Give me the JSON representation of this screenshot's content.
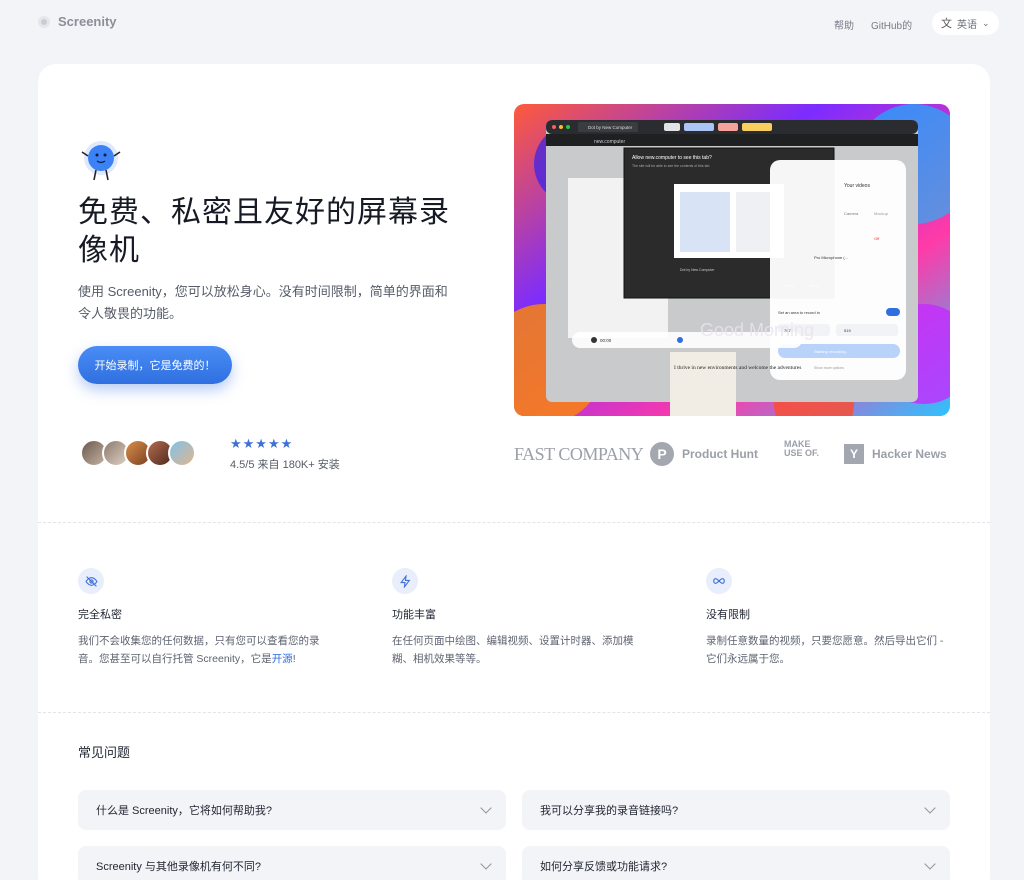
{
  "nav": {
    "brand": "Screenity",
    "help": "帮助",
    "github": "GitHub的",
    "language": "英语",
    "language_icon": "文"
  },
  "hero": {
    "title": "免费、私密且友好的屏幕录像机",
    "subtitle": "使用 Screenity，您可以放松身心。没有时间限制，简单的界面和令人敬畏的功能。",
    "cta": "开始录制，它是免费的！",
    "stars": "★★★★★",
    "rating": "4.5/5 来自 180K+ 安装"
  },
  "press": {
    "fast_company": "FAST COMPANY",
    "product_hunt": "Product Hunt",
    "product_hunt_letter": "P",
    "muo": "MAKE USE OF.",
    "hacker_news": "Hacker News",
    "hacker_news_letter": "Y"
  },
  "features": [
    {
      "icon": "eye-off-icon",
      "title": "完全私密",
      "desc_before": "我们不会收集您的任何数据，只有您可以查看您的录音。您甚至可以自行托管 Screenity，它是",
      "link": "开源",
      "desc_after": "!"
    },
    {
      "icon": "lightning-icon",
      "title": "功能丰富",
      "desc": "在任何页面中绘图、编辑视频、设置计时器、添加模糊、相机效果等等。"
    },
    {
      "icon": "infinity-icon",
      "title": "没有限制",
      "desc": "录制任意数量的视频，只要您愿意。然后导出它们 - 它们永远属于您。"
    }
  ],
  "faq": {
    "heading": "常见问题",
    "items": [
      "什么是 Screenity，它将如何帮助我?",
      "我可以分享我的录音链接吗?",
      "Screenity 与其他录像机有何不同?",
      "如何分享反馈或功能请求?"
    ]
  },
  "screenshot": {
    "dialog_title": "Allow new.computer to see this tab?",
    "dialog_sub": "The site will be able to see the contents of this tab",
    "dialog_tab": "Dot by New Computer",
    "dialog_cancel": "Cancel",
    "dialog_allow": "Allow",
    "url": "new.computer",
    "tab_title": "Dot by New Computer",
    "panel_title": "Your videos",
    "panel_camera": "Camera",
    "panel_mockup": "Mockup",
    "panel_mic": "Pro Microphone (...",
    "panel_off": "Off",
    "panel_area": "Set an area to record in",
    "panel_w": "757",
    "panel_h": "519",
    "panel_start": "Starting recording...",
    "panel_more": "Show more options",
    "timer": "00:00",
    "good_morning": "Good Morning",
    "thrive": "I thrive in new environments and welcome the adventures"
  }
}
